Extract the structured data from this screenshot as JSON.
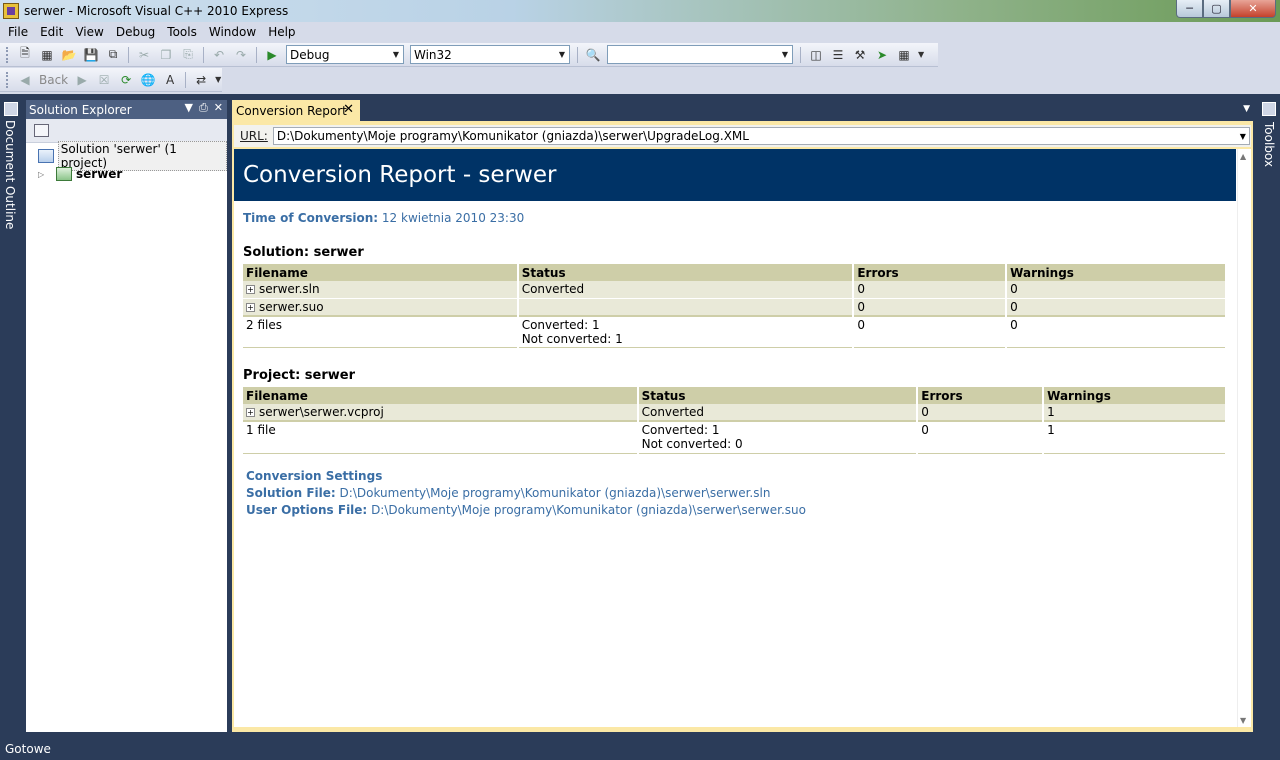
{
  "window": {
    "title": "serwer - Microsoft Visual C++ 2010 Express"
  },
  "menu": [
    "File",
    "Edit",
    "View",
    "Debug",
    "Tools",
    "Window",
    "Help"
  ],
  "toolbar": {
    "config": "Debug",
    "platform": "Win32",
    "find_value": "",
    "back_label": "Back"
  },
  "left_tab": {
    "label": "Document Outline"
  },
  "right_tab": {
    "label": "Toolbox"
  },
  "solution_explorer": {
    "title": "Solution Explorer",
    "solution_label": "Solution 'serwer' (1 project)",
    "project_label": "serwer"
  },
  "document": {
    "tab_label": "Conversion Report",
    "url_label": "URL:",
    "url": "D:\\Dokumenty\\Moje programy\\Komunikator (gniazda)\\serwer\\UpgradeLog.XML"
  },
  "report": {
    "title": "Conversion Report - serwer",
    "time_label": "Time of Conversion:",
    "time_value": "12 kwietnia 2010 23:30",
    "solution": {
      "heading": "Solution: serwer",
      "headers": [
        "Filename",
        "Status",
        "Errors",
        "Warnings"
      ],
      "rows": [
        {
          "file": "serwer.sln",
          "status": "Converted",
          "errors": "0",
          "warnings": "0"
        },
        {
          "file": "serwer.suo",
          "status": "",
          "errors": "0",
          "warnings": "0"
        }
      ],
      "total": {
        "file": "2 files",
        "converted": "Converted: 1",
        "not_converted": "Not converted: 1",
        "errors": "0",
        "warnings": "0"
      }
    },
    "project": {
      "heading": "Project: serwer",
      "headers": [
        "Filename",
        "Status",
        "Errors",
        "Warnings"
      ],
      "rows": [
        {
          "file": "serwer\\serwer.vcproj",
          "status": "Converted",
          "errors": "0",
          "warnings": "1"
        }
      ],
      "total": {
        "file": "1 file",
        "converted": "Converted: 1",
        "not_converted": "Not converted: 0",
        "errors": "0",
        "warnings": "1"
      }
    },
    "settings": {
      "heading": "Conversion Settings",
      "solution_file_label": "Solution File:",
      "solution_file": "D:\\Dokumenty\\Moje programy\\Komunikator (gniazda)\\serwer\\serwer.sln",
      "user_options_label": "User Options File:",
      "user_options": "D:\\Dokumenty\\Moje programy\\Komunikator (gniazda)\\serwer\\serwer.suo"
    }
  },
  "status": {
    "text": "Gotowe"
  },
  "colors": {
    "banner": "#003366",
    "table_header": "#cecea8",
    "link": "#3a6ea5",
    "tab_active": "#fbe8a6"
  }
}
